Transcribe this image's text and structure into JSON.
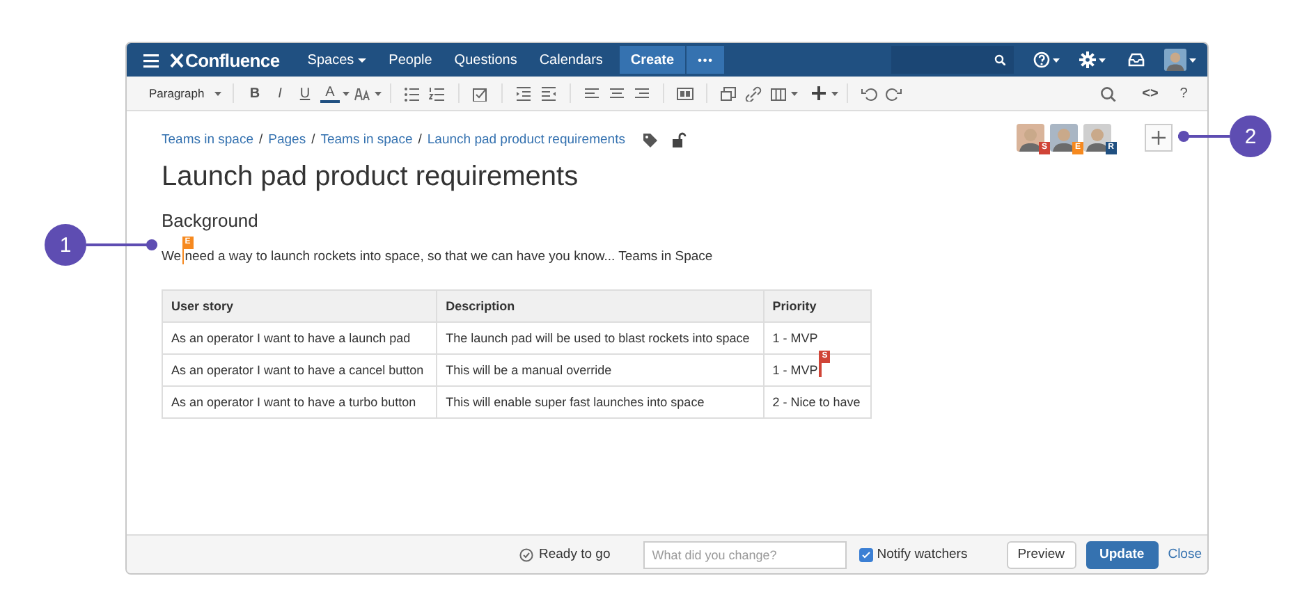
{
  "nav": {
    "logo": "Confluence",
    "items": [
      {
        "label": "Spaces",
        "dropdown": true
      },
      {
        "label": "People",
        "dropdown": false
      },
      {
        "label": "Questions",
        "dropdown": false
      },
      {
        "label": "Calendars",
        "dropdown": false
      }
    ],
    "create": "Create",
    "more": "•••"
  },
  "toolbar": {
    "style": "Paragraph",
    "format": [
      "B",
      "I",
      "U",
      "A"
    ],
    "right": [
      "<>",
      "?"
    ]
  },
  "breadcrumbs": {
    "separator": "/",
    "items": [
      "Teams in space",
      "Pages",
      "Teams in space",
      "Launch pad product requirements"
    ]
  },
  "collaborators": [
    {
      "initial": "S",
      "color": "#d04437"
    },
    {
      "initial": "E",
      "color": "#f6891f"
    },
    {
      "initial": "R",
      "color": "#205081"
    }
  ],
  "title": "Launch pad product requirements",
  "heading": "Background",
  "paragraph": {
    "text_before_cursor": "We ",
    "text_after_cursor": "need a way to launch rockets into space, so that we can have you know... Teams in Space",
    "cursor": {
      "initial": "E",
      "color": "#f6891f"
    }
  },
  "table": {
    "columns": [
      "User story",
      "Description",
      "Priority"
    ],
    "rows": [
      {
        "cells": [
          {
            "text": "As an operator I want to have a launch pad"
          },
          {
            "text": "The launch pad will be used to blast rockets into space"
          },
          {
            "text": "1 - MVP"
          }
        ]
      },
      {
        "cells": [
          {
            "text": "As an operator I want to have a cancel button"
          },
          {
            "text": "This will be a manual override"
          },
          {
            "text": "1 - MVP",
            "cursor": {
              "initial": "S",
              "color": "#d04437"
            }
          }
        ]
      },
      {
        "cells": [
          {
            "text": "As an operator I want to have a turbo button"
          },
          {
            "text": "This will enable super fast launches into space"
          },
          {
            "text": "2 - Nice to have"
          }
        ]
      }
    ]
  },
  "footer": {
    "status": "Ready to go",
    "comment_placeholder": "What did you change?",
    "notify": {
      "label": "Notify watchers",
      "checked": true
    },
    "preview": "Preview",
    "update": "Update",
    "close": "Close"
  },
  "callouts": [
    "1",
    "2"
  ]
}
